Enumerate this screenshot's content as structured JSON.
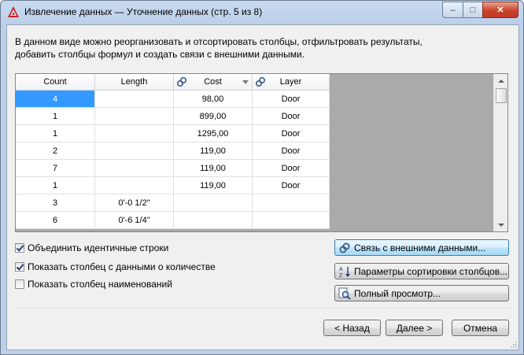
{
  "window": {
    "title": "Извлечение данных — Уточнение данных (стр. 5 из 8)",
    "controls": {
      "minimize": "–",
      "maximize": "□",
      "close": "✕"
    }
  },
  "description": {
    "line1": "В данном виде можно реорганизовать и отсортировать столбцы, отфильтровать результаты,",
    "line2": "добавить столбцы формул и создать связи с внешними данными."
  },
  "grid": {
    "columns": [
      "Count",
      "Length",
      "Cost",
      "Layer"
    ],
    "rows": [
      {
        "count": "4",
        "length": "",
        "cost": "98,00",
        "layer": "Door"
      },
      {
        "count": "1",
        "length": "",
        "cost": "899,00",
        "layer": "Door"
      },
      {
        "count": "1",
        "length": "",
        "cost": "1295,00",
        "layer": "Door"
      },
      {
        "count": "2",
        "length": "",
        "cost": "119,00",
        "layer": "Door"
      },
      {
        "count": "7",
        "length": "",
        "cost": "119,00",
        "layer": "Door"
      },
      {
        "count": "1",
        "length": "",
        "cost": "119,00",
        "layer": "Door"
      },
      {
        "count": "3",
        "length": "0'-0 1/2\"",
        "cost": "",
        "layer": ""
      },
      {
        "count": "6",
        "length": "0'-6 1/4\"",
        "cost": "",
        "layer": ""
      }
    ]
  },
  "options": {
    "combine_rows": {
      "label": "Объединить идентичные строки",
      "checked": true
    },
    "show_count": {
      "label": "Показать столбец с данными о количестве",
      "checked": true
    },
    "show_name": {
      "label": "Показать столбец наименований",
      "checked": false
    }
  },
  "actions": {
    "link_external": "Связь с внешними данными...",
    "sort_params": "Параметры сортировки столбцов...",
    "full_preview": "Полный просмотр..."
  },
  "nav": {
    "back": "< Назад",
    "next": "Далее >",
    "cancel": "Отмена"
  },
  "colors": {
    "selection": "#3399ff",
    "title_bar": "#bcd0ea",
    "close_button": "#c9432a"
  }
}
